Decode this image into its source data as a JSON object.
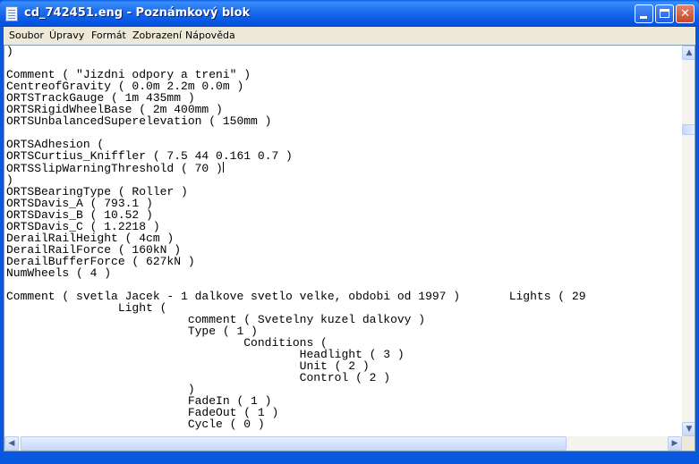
{
  "window": {
    "title": "cd_742451.eng - Poznámkový blok"
  },
  "titlebar_buttons": {
    "minimize": "",
    "maximize": "",
    "close": "✕"
  },
  "menu": {
    "items": [
      "Soubor",
      "Úpravy",
      "Formát",
      "Zobrazení",
      "Nápověda"
    ]
  },
  "editor": {
    "lines": [
      ")",
      "",
      "Comment ( \"Jizdni odpory a treni\" )",
      "CentreofGravity ( 0.0m 2.2m 0.0m )",
      "ORTSTrackGauge ( 1m 435mm )",
      "ORTSRigidWheelBase ( 2m 400mm )",
      "ORTSUnbalancedSuperelevation ( 150mm )",
      "",
      "ORTSAdhesion (",
      "ORTSCurtius_Kniffler ( 7.5 44 0.161 0.7 )",
      "ORTSSlipWarningThreshold ( 70 )",
      ")",
      "ORTSBearingType ( Roller )",
      "ORTSDavis_A ( 793.1 )",
      "ORTSDavis_B ( 10.52 )",
      "ORTSDavis_C ( 1.2218 )",
      "DerailRailHeight ( 4cm )",
      "DerailRailForce ( 160kN )",
      "DerailBufferForce ( 627kN )",
      "NumWheels ( 4 )",
      "",
      "Comment ( svetla Jacek - 1 dalkove svetlo velke, obdobi od 1997 )       Lights ( 29",
      "                Light (",
      "                          comment ( Svetelny kuzel dalkovy )",
      "                          Type ( 1 )",
      "                                  Conditions (",
      "                                          Headlight ( 3 )",
      "                                          Unit ( 2 )",
      "                                          Control ( 2 )",
      "                          )",
      "                          FadeIn ( 1 )",
      "                          FadeOut ( 1 )",
      "                          Cycle ( 0 )"
    ],
    "caret_line": 10
  },
  "scrollbars": {
    "up_arrow": "▲",
    "down_arrow": "▼",
    "left_arrow": "◀",
    "right_arrow": "▶"
  }
}
